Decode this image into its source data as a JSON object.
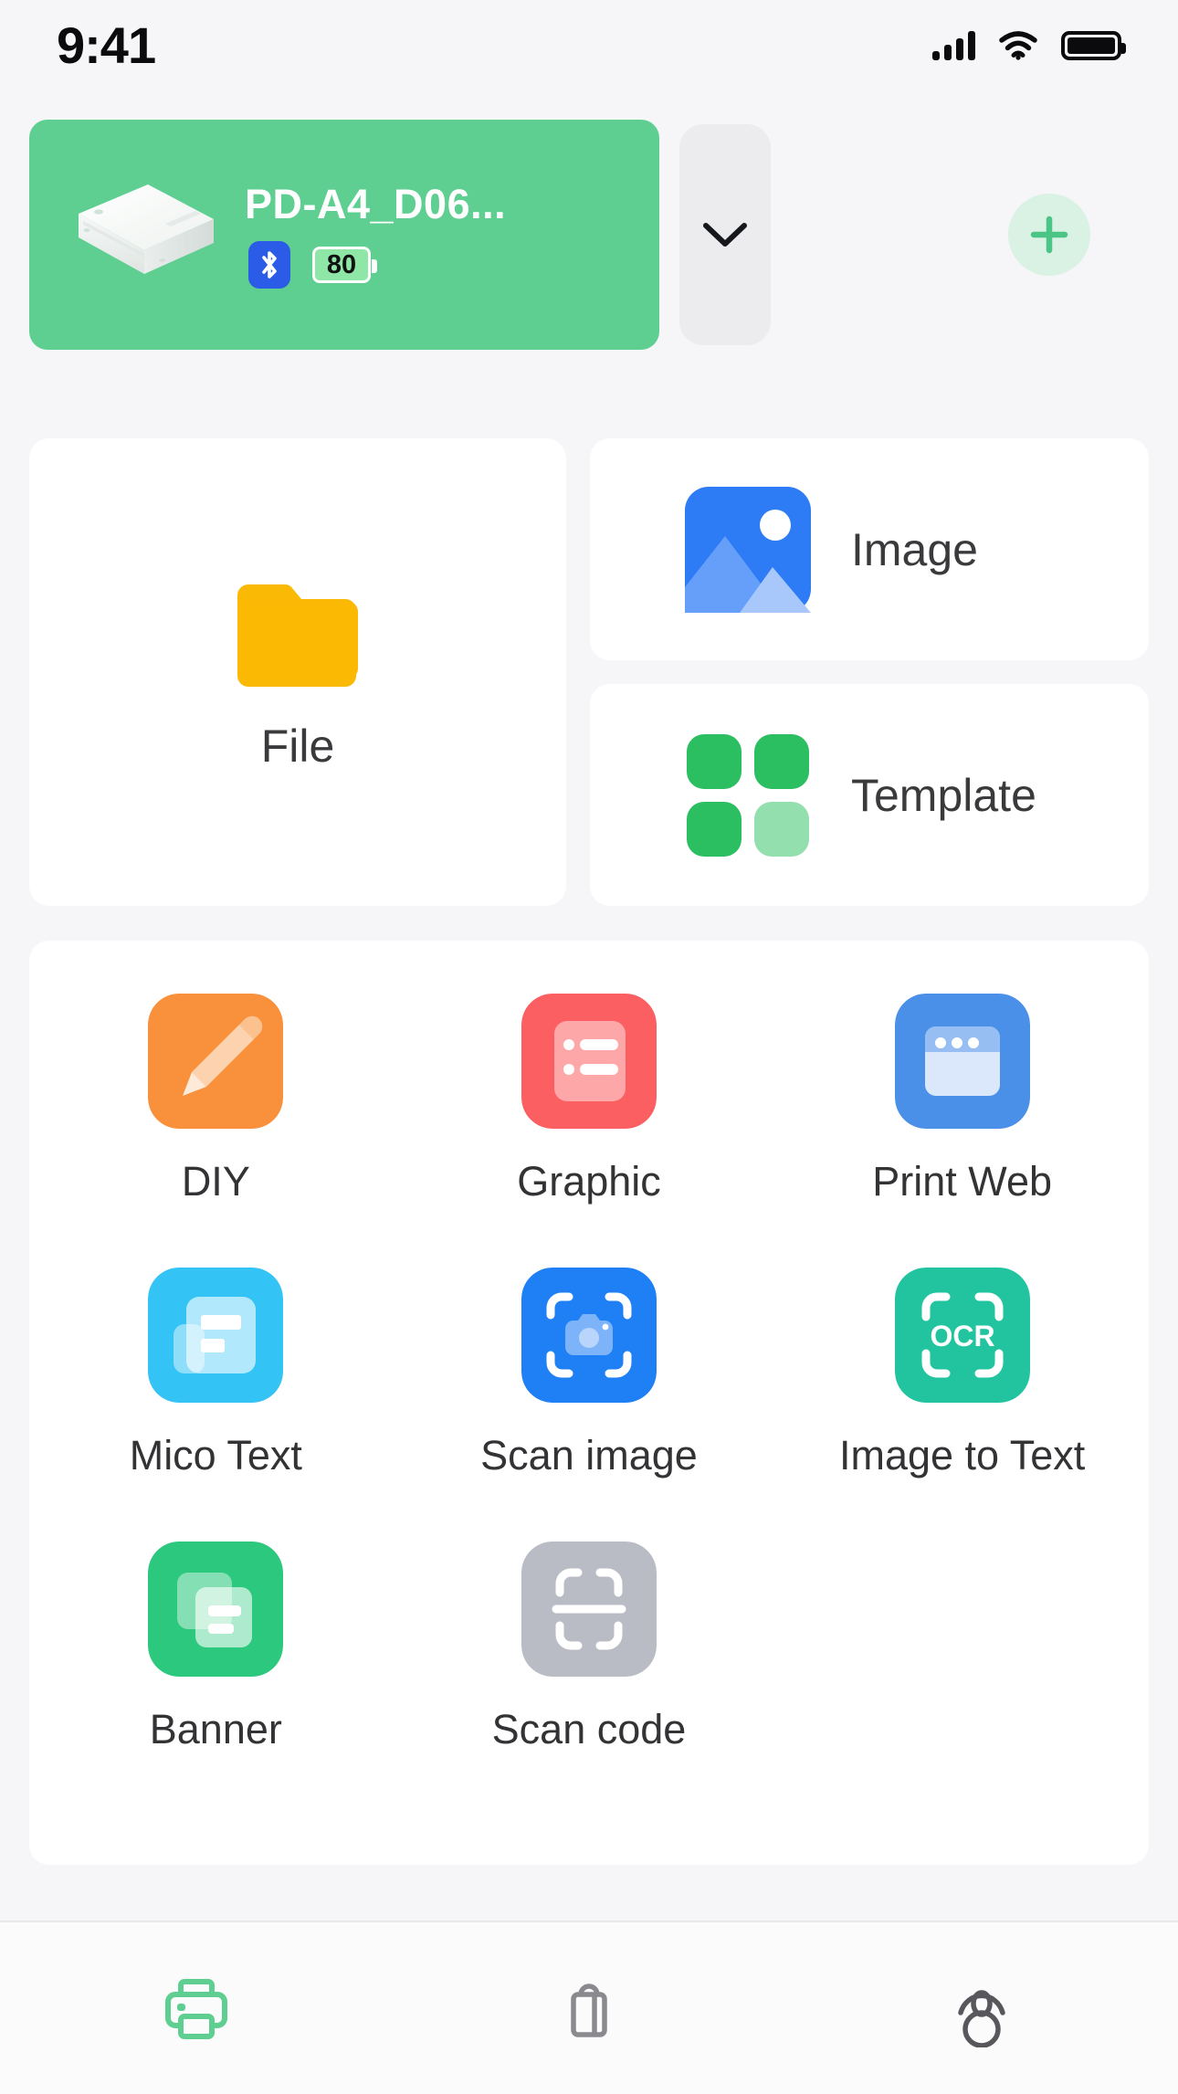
{
  "status_bar": {
    "time": "9:41",
    "signal_icon": "cellular-signal-icon",
    "wifi_icon": "wifi-icon",
    "battery_icon": "battery-full-icon"
  },
  "device": {
    "name": "PD-A4_D06...",
    "illustration": "portable-printer-illustration",
    "bluetooth_icon": "bluetooth-icon",
    "battery_level": "80",
    "card_color": "#5ecf91",
    "expand_icon": "chevron-down-icon",
    "add_icon": "plus-icon"
  },
  "quick_actions": [
    {
      "label": "File",
      "icon": "folder-icon",
      "color": "#f9b000"
    },
    {
      "label": "Image",
      "icon": "picture-icon",
      "color": "#2e7bf6"
    },
    {
      "label": "Template",
      "icon": "grid-four-icon",
      "color": "#2fbf63"
    }
  ],
  "tools": [
    {
      "label": "DIY",
      "icon": "pencil-icon",
      "color": "#f8903c"
    },
    {
      "label": "Graphic",
      "icon": "list-card-icon",
      "color": "#fb5f62"
    },
    {
      "label": "Print Web",
      "icon": "browser-window-icon",
      "color": "#4a90e8"
    },
    {
      "label": "Mico Text",
      "icon": "document-text-icon",
      "color": "#34c3f5"
    },
    {
      "label": "Scan image",
      "icon": "scan-camera-icon",
      "color": "#1f7ff5"
    },
    {
      "label": "Image to Text",
      "icon": "ocr-scan-icon",
      "color": "#22c4a0"
    },
    {
      "label": "Banner",
      "icon": "banner-pages-icon",
      "color": "#2bc87e"
    },
    {
      "label": "Scan code",
      "icon": "scan-code-icon",
      "color": "#b9bcc4"
    }
  ],
  "tab_bar": [
    {
      "name": "printer",
      "icon": "printer-icon",
      "active": true,
      "color": "#5ecf91"
    },
    {
      "name": "shop",
      "icon": "shopping-bag-icon",
      "active": false,
      "color": "#808084"
    },
    {
      "name": "profile",
      "icon": "user-account-icon",
      "active": false,
      "color": "#58585c"
    }
  ]
}
